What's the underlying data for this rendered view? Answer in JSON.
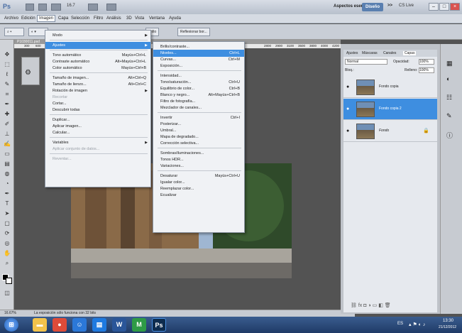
{
  "appbar": {
    "ps": "Ps",
    "zoom": "16.7",
    "zoom2": "100%",
    "workspace": "Aspectos esenciales",
    "design": "Diseño",
    "more": ">>",
    "cslive": "CS Live"
  },
  "menubar": [
    "Archivo",
    "Edición",
    "Imagen",
    "Capa",
    "Selección",
    "Filtro",
    "Análisis",
    "3D",
    "Vista",
    "Ventana",
    "Ayuda"
  ],
  "options": {
    "btn1": "Brillo",
    "btn2": "Reflexionar bor..."
  },
  "doc_tab": "P1030011.psd",
  "ruler": [
    "300",
    "600",
    "2800",
    "2900",
    "3100",
    "3500",
    "3800",
    "4000",
    "4200",
    "4"
  ],
  "imagen_menu": [
    {
      "label": "Modo",
      "shortcut": "",
      "submenu": true
    },
    {
      "sep": true
    },
    {
      "label": "Ajustes",
      "shortcut": "",
      "submenu": true,
      "hi": true
    },
    {
      "sep": true
    },
    {
      "label": "Tono automático",
      "shortcut": "Mayús+Ctrl+L"
    },
    {
      "label": "Contraste automático",
      "shortcut": "Alt+Mayús+Ctrl+L"
    },
    {
      "label": "Color automático",
      "shortcut": "Mayús+Ctrl+B"
    },
    {
      "sep": true
    },
    {
      "label": "Tamaño de imagen...",
      "shortcut": "Alt+Ctrl+Q"
    },
    {
      "label": "Tamaño de lienzo...",
      "shortcut": "Alt+Ctrl+C"
    },
    {
      "label": "Rotación de imagen",
      "shortcut": "",
      "submenu": true
    },
    {
      "label": "Recortar",
      "shortcut": "",
      "dis": true
    },
    {
      "label": "Cortar...",
      "shortcut": ""
    },
    {
      "label": "Descubrir todas",
      "shortcut": ""
    },
    {
      "sep": true
    },
    {
      "label": "Duplicar...",
      "shortcut": ""
    },
    {
      "label": "Aplicar imagen...",
      "shortcut": ""
    },
    {
      "label": "Calcular...",
      "shortcut": ""
    },
    {
      "sep": true
    },
    {
      "label": "Variables",
      "shortcut": "",
      "submenu": true
    },
    {
      "label": "Aplicar conjunto de datos...",
      "shortcut": "",
      "dis": true
    },
    {
      "sep": true
    },
    {
      "label": "Reventar...",
      "shortcut": "",
      "dis": true
    }
  ],
  "ajustes_menu": [
    {
      "label": "Brillo/contraste..."
    },
    {
      "label": "Niveles...",
      "shortcut": "Ctrl+L",
      "hi": true
    },
    {
      "label": "Curvas...",
      "shortcut": "Ctrl+M"
    },
    {
      "label": "Exposición..."
    },
    {
      "sep": true
    },
    {
      "label": "Intensidad..."
    },
    {
      "label": "Tono/saturación...",
      "shortcut": "Ctrl+U"
    },
    {
      "label": "Equilibrio de color...",
      "shortcut": "Ctrl+B"
    },
    {
      "label": "Blanco y negro...",
      "shortcut": "Alt+Mayús+Ctrl+B"
    },
    {
      "label": "Filtro de fotografía..."
    },
    {
      "label": "Mezclador de canales..."
    },
    {
      "sep": true
    },
    {
      "label": "Invertir",
      "shortcut": "Ctrl+I"
    },
    {
      "label": "Posterizar..."
    },
    {
      "label": "Umbral..."
    },
    {
      "label": "Mapa de degradado..."
    },
    {
      "label": "Corrección selectiva..."
    },
    {
      "sep": true
    },
    {
      "label": "Sombras/iluminaciones..."
    },
    {
      "label": "Tonos HDR..."
    },
    {
      "label": "Variaciones..."
    },
    {
      "sep": true
    },
    {
      "label": "Desaturar",
      "shortcut": "Mayús+Ctrl+U"
    },
    {
      "label": "Igualar color..."
    },
    {
      "label": "Reemplazar color..."
    },
    {
      "label": "Ecualizar"
    }
  ],
  "layers": {
    "tabs": [
      "Ajustes",
      "Máscaras",
      "Canales",
      "Capas"
    ],
    "blend": "Normal",
    "opacity_label": "Opacidad:",
    "opacity": "100%",
    "lock_label": "Bloq.:",
    "fill_label": "Relleno:",
    "fill": "100%",
    "rows": [
      {
        "name": "Fondo copia",
        "selected": false
      },
      {
        "name": "Fondo copia 2",
        "selected": true
      },
      {
        "name": "Fondo",
        "selected": false
      }
    ]
  },
  "status": {
    "zoom": "16.67%",
    "msg": "La exposición sólo funciona con 32 bits"
  },
  "tray": {
    "lang": "ES",
    "time": "13:30",
    "date": "21/12/2012"
  }
}
